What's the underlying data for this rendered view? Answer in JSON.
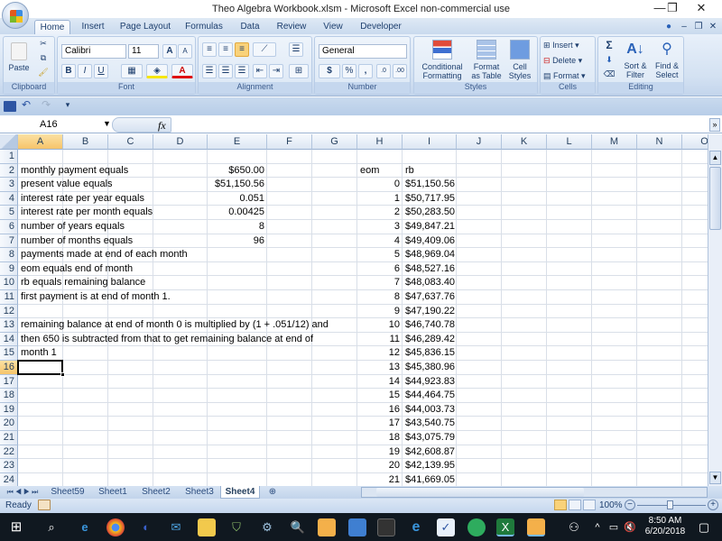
{
  "window": {
    "title": "Theo Algebra Workbook.xlsm - Microsoft Excel non-commercial use",
    "controls": {
      "minimize": "—",
      "restore": "❐",
      "close": "✕"
    }
  },
  "ribbon_tabs": [
    "Home",
    "Insert",
    "Page Layout",
    "Formulas",
    "Data",
    "Review",
    "View",
    "Developer"
  ],
  "active_tab": "Home",
  "ribbon": {
    "clipboard": {
      "label": "Clipboard",
      "paste": "Paste"
    },
    "font": {
      "label": "Font",
      "font_name": "Calibri",
      "font_size": "11",
      "bold": "B",
      "italic": "I",
      "underline": "U"
    },
    "alignment": {
      "label": "Alignment"
    },
    "number": {
      "label": "Number",
      "format": "General",
      "currency": "$",
      "percent": "%",
      "comma": ","
    },
    "styles": {
      "label": "Styles",
      "conditional": "Conditional Formatting",
      "format_table": "Format as Table",
      "cell_styles": "Cell Styles"
    },
    "cells": {
      "label": "Cells",
      "insert": "Insert",
      "delete": "Delete",
      "format": "Format"
    },
    "editing": {
      "label": "Editing",
      "sort_filter": "Sort & Filter",
      "find_select": "Find & Select"
    }
  },
  "formula_bar": {
    "name_box": "A16",
    "fx": "fx",
    "formula": ""
  },
  "columns": [
    "A",
    "B",
    "C",
    "D",
    "E",
    "F",
    "G",
    "H",
    "I",
    "J",
    "K",
    "L",
    "M",
    "N",
    "O"
  ],
  "rows": [
    "1",
    "2",
    "3",
    "4",
    "5",
    "6",
    "7",
    "8",
    "9",
    "10",
    "11",
    "12",
    "13",
    "14",
    "15",
    "16",
    "17",
    "18",
    "19",
    "20",
    "21",
    "22",
    "23",
    "24"
  ],
  "selected_cell": "A16",
  "cells": {
    "A2": "monthly payment equals",
    "E2": "$650.00",
    "A3": "present value equals",
    "E3": "$51,150.56",
    "A4": "interest rate per year equals",
    "E4": "0.051",
    "A5": "interest rate per month equals",
    "E5": "0.00425",
    "A6": "number of years equals",
    "E6": "8",
    "A7": "number of months equals",
    "E7": "96",
    "A8": "payments made at end of each month",
    "A9": "eom equals end of month",
    "A10": "rb equals remaining balance",
    "A11": "first payment is at end of month 1.",
    "A13": "remaining balance at end of month 0 is multiplied by (1 + .051/12) and",
    "A14": "then 650 is subtracted from that to get remaining balance at end of",
    "A15": "month 1",
    "H2": "eom",
    "I2": "rb"
  },
  "table": {
    "eom": [
      "0",
      "1",
      "2",
      "3",
      "4",
      "5",
      "6",
      "7",
      "8",
      "9",
      "10",
      "11",
      "12",
      "13",
      "14",
      "15",
      "16",
      "17",
      "18",
      "19",
      "20",
      "21"
    ],
    "rb": [
      "$51,150.56",
      "$50,717.95",
      "$50,283.50",
      "$49,847.21",
      "$49,409.06",
      "$48,969.04",
      "$48,527.16",
      "$48,083.40",
      "$47,637.76",
      "$47,190.22",
      "$46,740.78",
      "$46,289.42",
      "$45,836.15",
      "$45,380.96",
      "$44,923.83",
      "$44,464.75",
      "$44,003.73",
      "$43,540.75",
      "$43,075.79",
      "$42,608.87",
      "$42,139.95",
      "$41,669.05"
    ]
  },
  "sheet_tabs": [
    "Sheet59",
    "Sheet1",
    "Sheet2",
    "Sheet3",
    "Sheet4"
  ],
  "active_sheet": "Sheet4",
  "status": {
    "text": "Ready",
    "zoom": "100%"
  },
  "taskbar": {
    "time": "8:50 AM",
    "date": "6/20/2018"
  }
}
